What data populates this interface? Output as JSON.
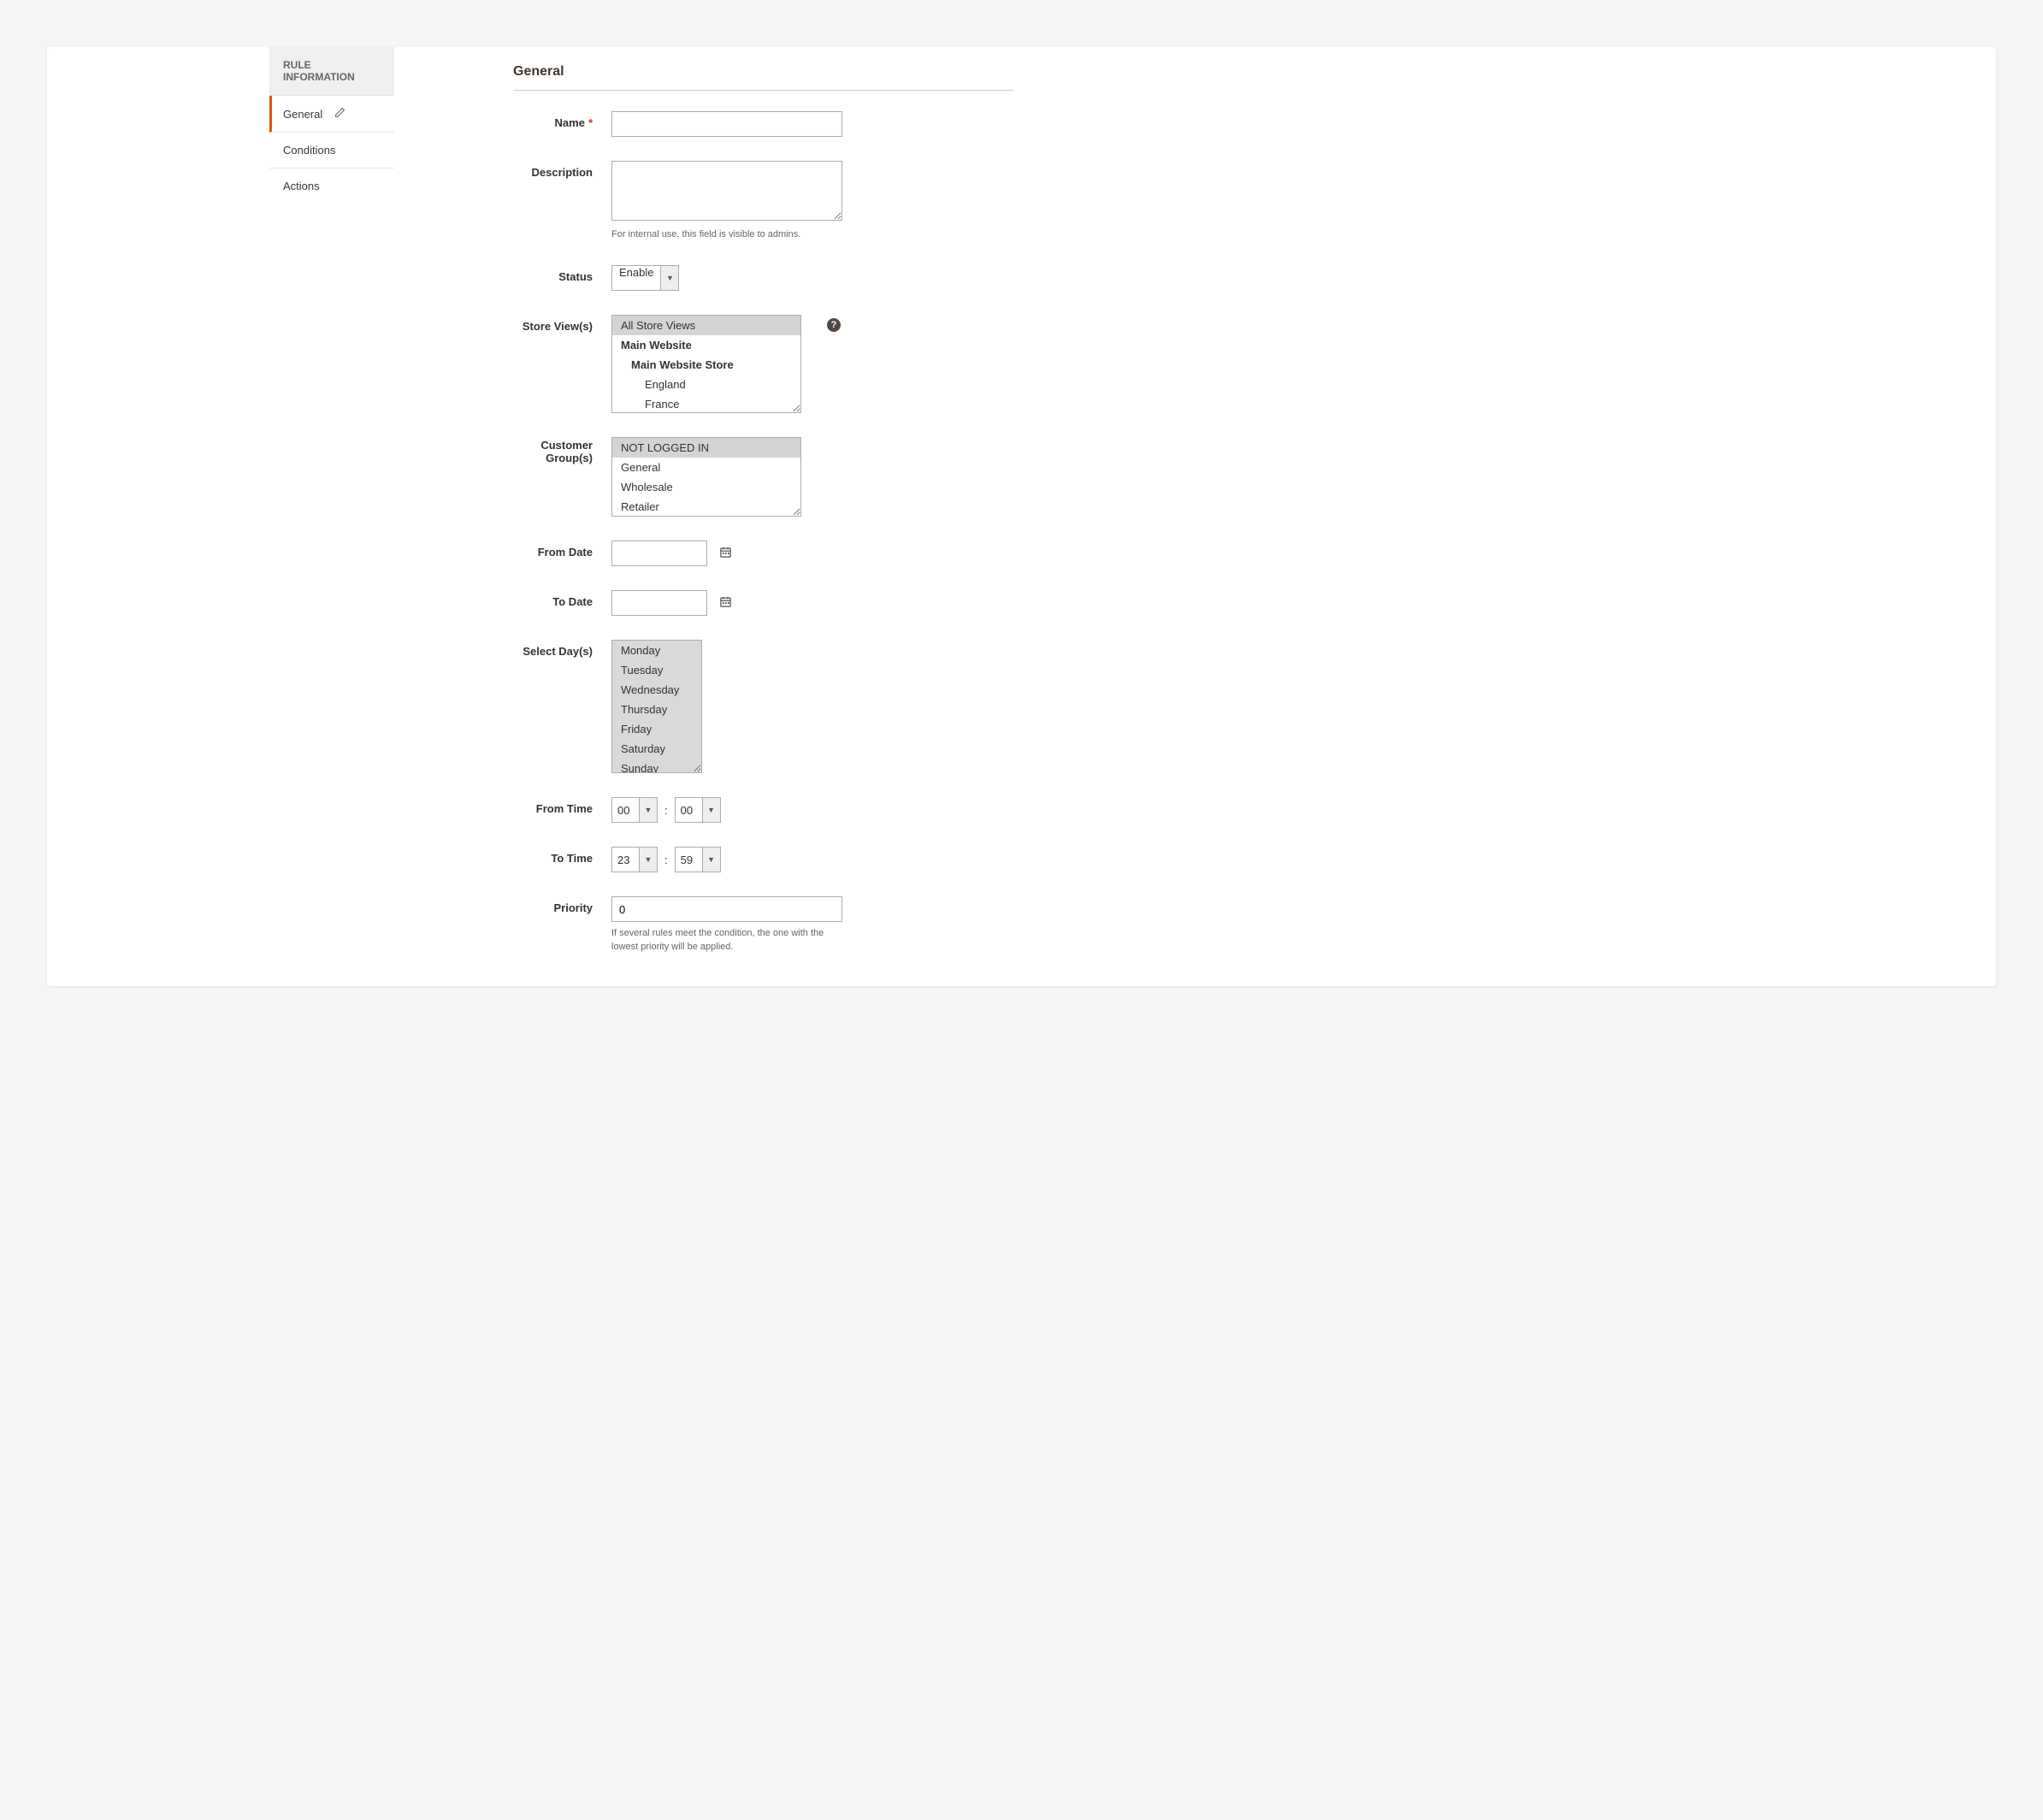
{
  "sidebar": {
    "header": "RULE INFORMATION",
    "items": [
      {
        "label": "General",
        "active": true,
        "editable": true
      },
      {
        "label": "Conditions",
        "active": false
      },
      {
        "label": "Actions",
        "active": false
      }
    ]
  },
  "section_title": "General",
  "fields": {
    "name": {
      "label": "Name",
      "value": "",
      "required": true
    },
    "description": {
      "label": "Description",
      "value": "",
      "note": "For internal use, this field is visible to admins."
    },
    "status": {
      "label": "Status",
      "value": "Enable"
    },
    "store_views": {
      "label": "Store View(s)",
      "options": [
        {
          "label": "All Store Views",
          "selected": true,
          "level": 0
        },
        {
          "label": "Main Website",
          "bold": true,
          "level": 0
        },
        {
          "label": "Main Website Store",
          "bold": true,
          "level": 1
        },
        {
          "label": "England",
          "level": 2
        },
        {
          "label": "France",
          "level": 2
        }
      ]
    },
    "customer_groups": {
      "label": "Customer Group(s)",
      "options": [
        {
          "label": "NOT LOGGED IN",
          "selected": true
        },
        {
          "label": "General"
        },
        {
          "label": "Wholesale"
        },
        {
          "label": "Retailer"
        }
      ]
    },
    "from_date": {
      "label": "From Date",
      "value": ""
    },
    "to_date": {
      "label": "To Date",
      "value": ""
    },
    "select_days": {
      "label": "Select Day(s)",
      "options": [
        "Monday",
        "Tuesday",
        "Wednesday",
        "Thursday",
        "Friday",
        "Saturday",
        "Sunday"
      ]
    },
    "from_time": {
      "label": "From Time",
      "hour": "00",
      "minute": "00"
    },
    "to_time": {
      "label": "To Time",
      "hour": "23",
      "minute": "59"
    },
    "priority": {
      "label": "Priority",
      "value": "0",
      "note": "If several rules meet the condition, the one with the lowest priority will be applied."
    }
  }
}
